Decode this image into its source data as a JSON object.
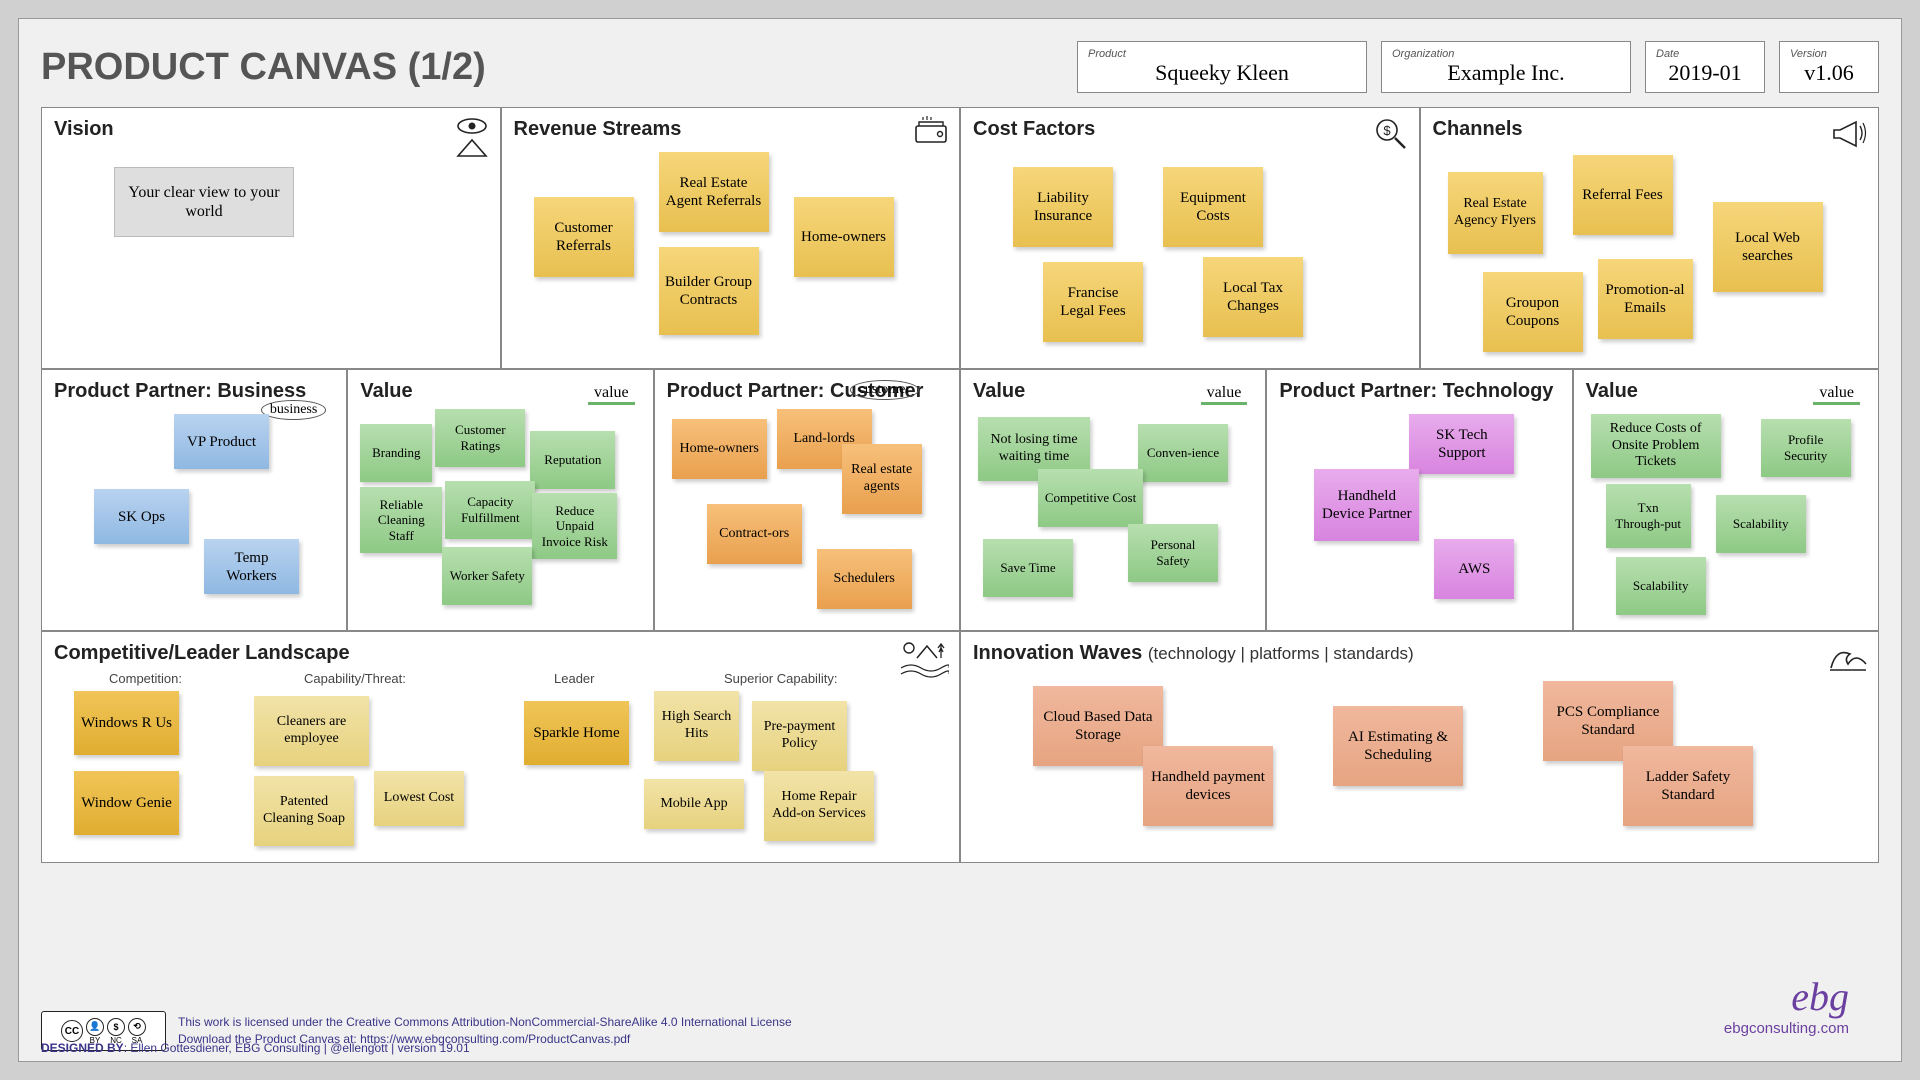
{
  "header": {
    "title": "PRODUCT CANVAS (1/2)",
    "productLabel": "Product",
    "productValue": "Squeeky Kleen",
    "orgLabel": "Organization",
    "orgValue": "Example Inc.",
    "dateLabel": "Date",
    "dateValue": "2019-01",
    "versionLabel": "Version",
    "versionValue": "v1.06"
  },
  "tags": {
    "value": "value",
    "business": "business",
    "customer": "customer"
  },
  "cells": {
    "vision": {
      "heading": "Vision",
      "tagline": "Your clear view to your world"
    },
    "revenue": {
      "heading": "Revenue Streams",
      "notes": [
        "Customer Referrals",
        "Real Estate Agent Referrals",
        "Builder Group Contracts",
        "Home-owners"
      ]
    },
    "cost": {
      "heading": "Cost Factors",
      "notes": [
        "Liability Insurance",
        "Equipment Costs",
        "Francise Legal Fees",
        "Local Tax Changes"
      ]
    },
    "channels": {
      "heading": "Channels",
      "notes": [
        "Real Estate Agency Flyers",
        "Referral Fees",
        "Local Web searches",
        "Groupon Coupons",
        "Promotion-al Emails"
      ]
    },
    "ppBiz": {
      "heading": "Product Partner: Business",
      "notes": [
        "VP Product",
        "SK Ops",
        "Temp Workers"
      ]
    },
    "valBiz": {
      "heading": "Value",
      "notes": [
        "Branding",
        "Customer Ratings",
        "Reputation",
        "Reliable Cleaning Staff",
        "Capacity Fulfillment",
        "Reduce Unpaid Invoice Risk",
        "Worker Safety"
      ]
    },
    "ppCust": {
      "heading": "Product Partner: Customer",
      "notes": [
        "Home-owners",
        "Land-lords",
        "Real estate agents",
        "Contract-ors",
        "Schedulers"
      ]
    },
    "valCust": {
      "heading": "Value",
      "notes": [
        "Not losing time waiting time",
        "Conven-ience",
        "Competitive Cost",
        "Save Time",
        "Personal Safety"
      ]
    },
    "ppTech": {
      "heading": "Product Partner: Technology",
      "notes": [
        "SK Tech Support",
        "Handheld Device Partner",
        "AWS"
      ]
    },
    "valTech": {
      "heading": "Value",
      "notes": [
        "Reduce Costs of Onsite Problem Tickets",
        "Profile Security",
        "Txn Through-put",
        "Scalability",
        "Scalability"
      ]
    },
    "comp": {
      "heading": "Competitive/Leader Landscape",
      "subCompetition": "Competition:",
      "subCapThreat": "Capability/Threat:",
      "subLeader": "Leader",
      "subSuperior": "Superior Capability:",
      "competition": [
        "Windows R Us",
        "Window Genie"
      ],
      "capThreat": [
        "Cleaners are employee",
        "Patented Cleaning Soap",
        "Lowest Cost"
      ],
      "leader": [
        "Sparkle Home"
      ],
      "superior": [
        "High Search Hits",
        "Pre-payment Policy",
        "Mobile App",
        "Home Repair Add-on Services"
      ]
    },
    "innov": {
      "heading": "Innovation Waves",
      "subheading": "(technology  |  platforms |  standards)",
      "notes": [
        "Cloud Based Data Storage",
        "Handheld payment devices",
        "AI Estimating & Scheduling",
        "PCS Compliance Standard",
        "Ladder Safety Standard"
      ]
    }
  },
  "footer": {
    "cc": {
      "by": "BY",
      "nc": "NC",
      "sa": "SA"
    },
    "license": "This work is licensed under the Creative Commons Attribution-NonCommercial-ShareAlike 4.0 International License",
    "download": "Download the Product Canvas at: https://www.ebgconsulting.com/ProductCanvas.pdf",
    "designed": "DESIGNED BY",
    "designedRest": ": Ellen Gottesdiener, EBG Consulting | @ellengott | version 19.01",
    "ebgLogo": "ebg",
    "ebgSite": "ebgconsulting.com"
  }
}
